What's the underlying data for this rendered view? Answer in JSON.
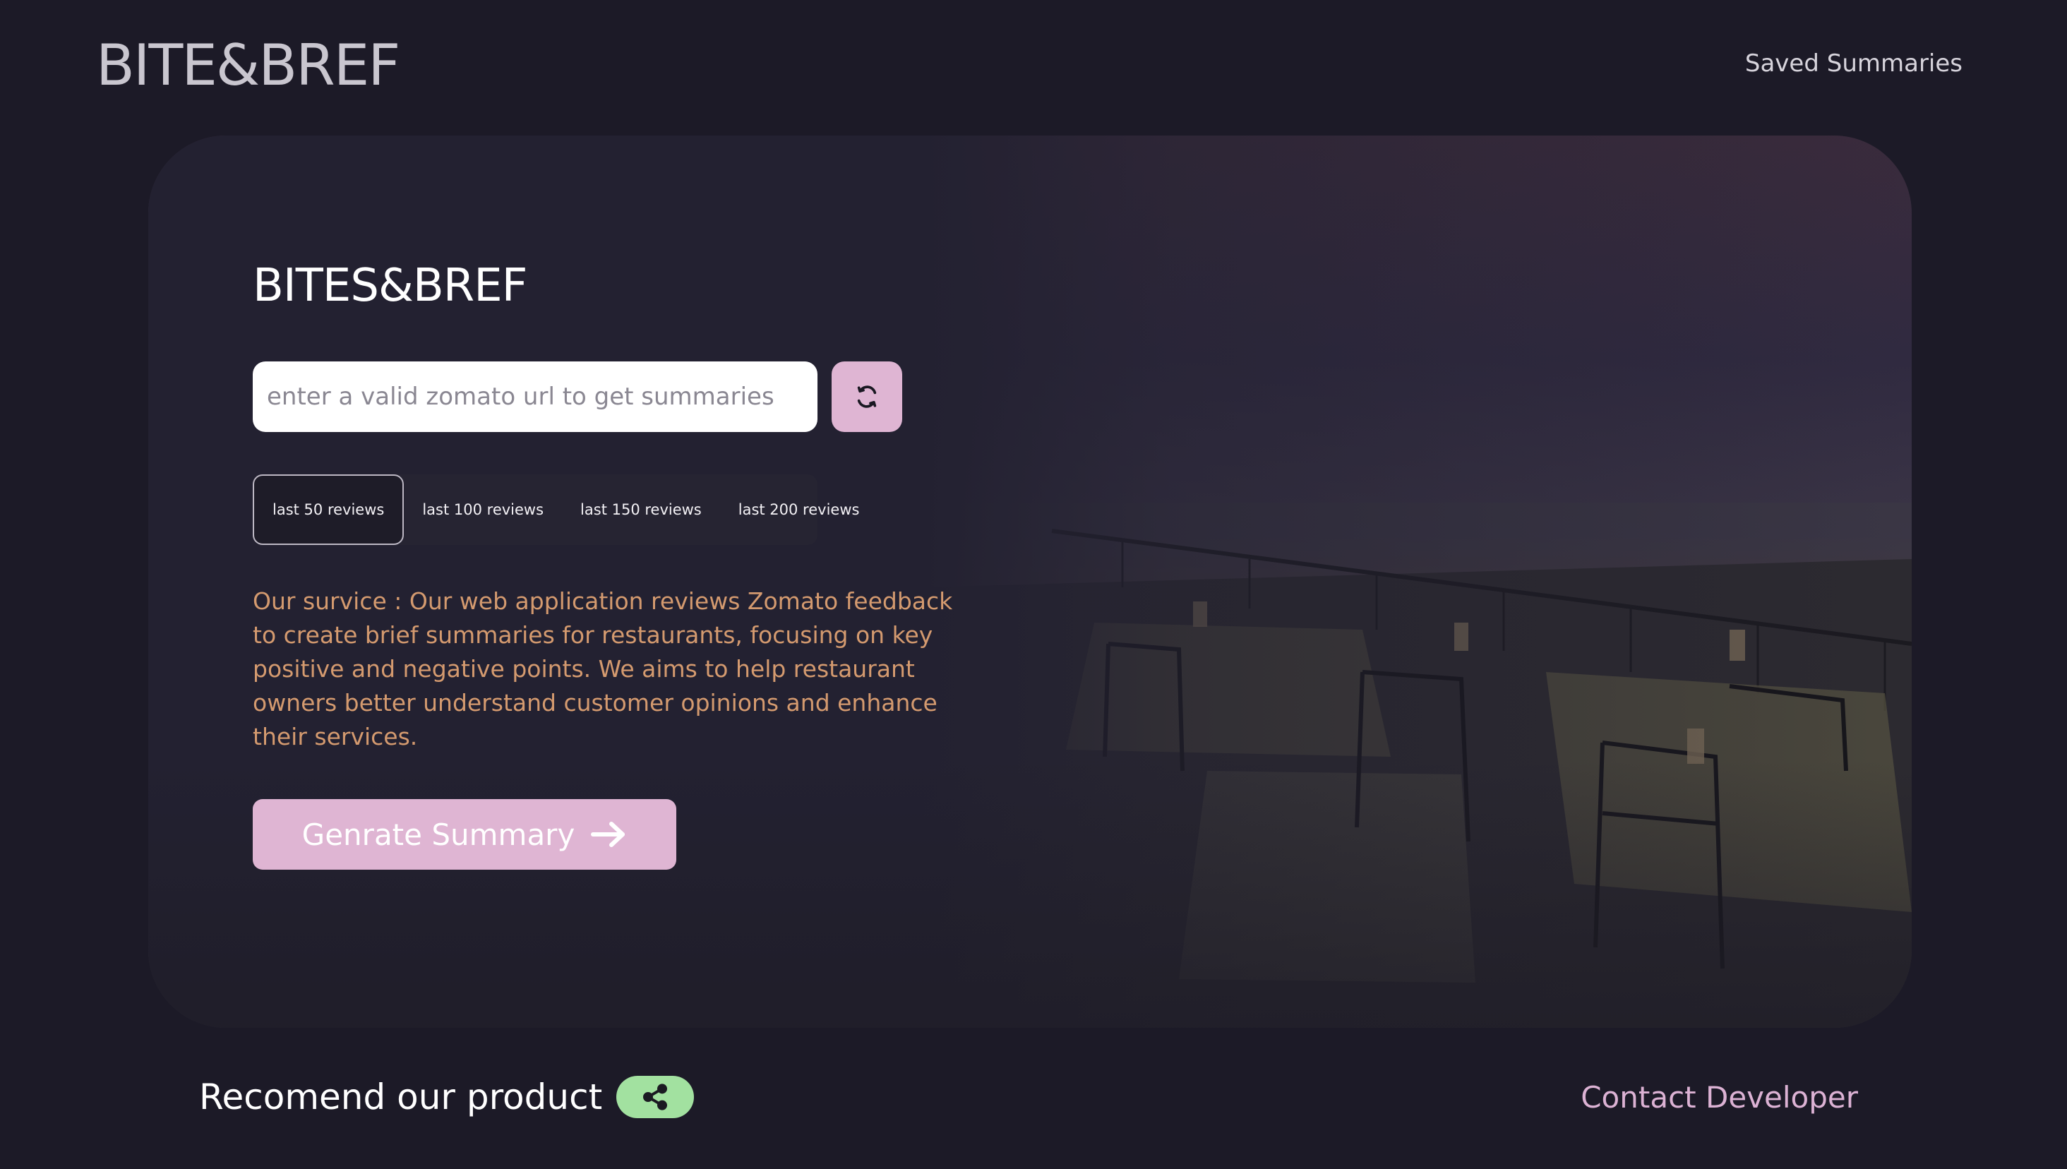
{
  "header": {
    "brand": "BITE&BREF",
    "nav_saved": "Saved Summaries"
  },
  "hero": {
    "title": "BITES&BREF",
    "url_input": {
      "placeholder": "enter a valid zomato url to get summaries",
      "value": ""
    },
    "refresh_icon": "refresh-icon",
    "review_tabs": [
      {
        "label": "last 50 reviews",
        "active": true
      },
      {
        "label": "last 100 reviews",
        "active": false
      },
      {
        "label": "last 150 reviews",
        "active": false
      },
      {
        "label": "last 200 reviews",
        "active": false
      }
    ],
    "service_text": "Our survice : Our web application reviews Zomato feedback to create brief summaries for restaurants, focusing on key positive and negative points. We aims to help restaurant owners better understand customer opinions and enhance their services.",
    "generate_label": "Genrate Summary",
    "generate_icon": "arrow-right-icon",
    "background_image": "seaside-restaurant-terrace-at-dusk"
  },
  "footer": {
    "recommend_label": "Recomend our product",
    "share_icon": "share-icon",
    "contact_label": "Contact Developer"
  },
  "colors": {
    "page_bg": "#1c1a27",
    "card_bg": "#232131",
    "accent_pink": "#dfb5d3",
    "service_text": "#d49a6f",
    "share_green": "#a2e1a0",
    "contact_text": "#dcb2d4"
  }
}
